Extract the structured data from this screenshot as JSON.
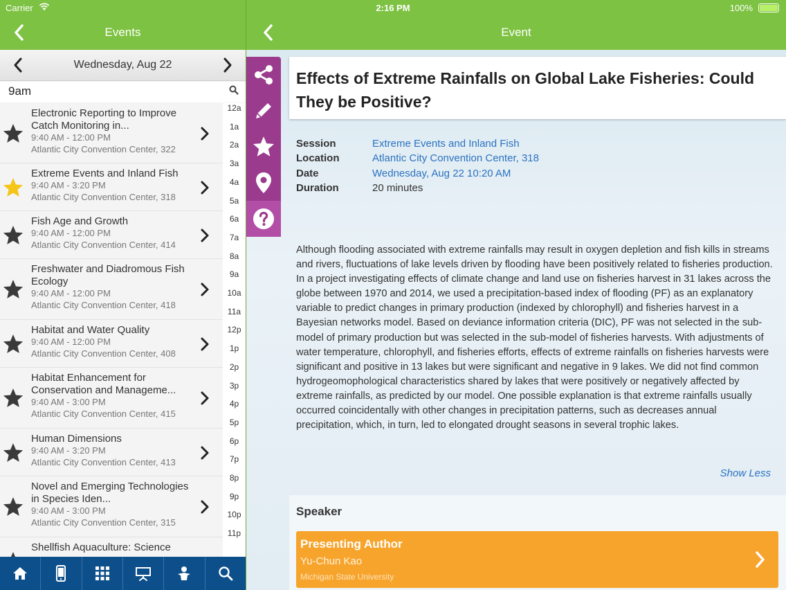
{
  "status_bar": {
    "carrier": "Carrier",
    "time": "2:16 PM",
    "battery": "100%"
  },
  "left_nav": {
    "title": "Events"
  },
  "right_nav": {
    "title": "Event"
  },
  "date_bar": {
    "date": "Wednesday, Aug 22"
  },
  "time_header": {
    "label": "9am"
  },
  "events": [
    {
      "title": "Electronic Reporting to Improve Catch Monitoring in...",
      "time": "9:40 AM - 12:00 PM",
      "location": "Atlantic City Convention Center, 322",
      "starred": false
    },
    {
      "title": "Extreme Events and Inland Fish",
      "time": "9:40 AM - 3:20 PM",
      "location": "Atlantic City Convention Center, 318",
      "starred": true
    },
    {
      "title": "Fish Age and Growth",
      "time": "9:40 AM - 12:00 PM",
      "location": "Atlantic City Convention Center, 414",
      "starred": false
    },
    {
      "title": "Freshwater and Diadromous Fish Ecology",
      "time": "9:40 AM - 12:00 PM",
      "location": "Atlantic City Convention Center, 418",
      "starred": false
    },
    {
      "title": "Habitat and Water Quality",
      "time": "9:40 AM - 12:00 PM",
      "location": "Atlantic City Convention Center, 408",
      "starred": false
    },
    {
      "title": "Habitat Enhancement for Conservation and Manageme...",
      "time": "9:40 AM - 3:00 PM",
      "location": "Atlantic City Convention Center, 415",
      "starred": false
    },
    {
      "title": "Human Dimensions",
      "time": "9:40 AM - 3:20 PM",
      "location": "Atlantic City Convention Center, 413",
      "starred": false
    },
    {
      "title": "Novel and Emerging Technologies in Species Iden...",
      "time": "9:40 AM - 3:00 PM",
      "location": "Atlantic City Convention Center, 315",
      "starred": false
    },
    {
      "title": "Shellfish Aquaculture: Science",
      "time": "",
      "location": "",
      "starred": false
    }
  ],
  "hour_index": [
    "12a",
    "1a",
    "2a",
    "3a",
    "4a",
    "5a",
    "6a",
    "7a",
    "8a",
    "9a",
    "10a",
    "11a",
    "12p",
    "1p",
    "2p",
    "3p",
    "4p",
    "5p",
    "6p",
    "7p",
    "8p",
    "9p",
    "10p",
    "11p"
  ],
  "tab_bar": {
    "tabs": [
      {
        "icon": "home-icon"
      },
      {
        "icon": "phone-icon"
      },
      {
        "icon": "grid-icon"
      },
      {
        "icon": "presentation-icon"
      },
      {
        "icon": "person-icon"
      },
      {
        "icon": "search-icon"
      }
    ]
  },
  "side_tools": [
    "share-icon",
    "pencil-icon",
    "star-icon",
    "location-pin-icon",
    "help-icon"
  ],
  "event_detail": {
    "title": "Effects of Extreme Rainfalls on Global Lake Fisheries: Could They be Positive?",
    "fields": [
      {
        "key": "Session",
        "value": "Extreme Events and Inland Fish",
        "link": true
      },
      {
        "key": "Location",
        "value": "Atlantic City Convention Center, 318",
        "link": true
      },
      {
        "key": "Date",
        "value": "Wednesday, Aug 22 10:20 AM",
        "link": true
      },
      {
        "key": "Duration",
        "value": "20 minutes",
        "link": false
      }
    ],
    "abstract": "Although flooding associated with extreme rainfalls may result in oxygen depletion and fish kills in streams and rivers, fluctuations of lake levels driven by flooding have been positively related to fisheries production. In a project investigating effects of climate change and land use on fisheries harvest in 31 lakes across the globe between 1970 and 2014, we used a precipitation-based index of flooding (PF) as an explanatory variable to predict changes in primary production (indexed by chlorophyll) and fisheries harvest in a Bayesian networks model. Based on deviance information criteria (DIC), PF was not selected in the sub-model of primary production but was selected in the sub-model of fisheries harvests. With adjustments of water temperature, chlorophyll, and fisheries efforts, effects of extreme rainfalls on fisheries harvests were significant and positive in 13 lakes but were significant and negative in 9 lakes. We did not find common hydrogeomophological characteristics shared by lakes that were positively or negatively affected by extreme rainfalls, as predicted by our model. One possible explanation is that extreme rainfalls usually occurred coincidentally with other changes in precipitation patterns, such as decreases annual precipitation, which, in turn, led to elongated drought seasons in several trophic lakes.",
    "show_less": "Show Less"
  },
  "speaker": {
    "heading": "Speaker",
    "role": "Presenting Author",
    "name": "Yu-Chun Kao",
    "organization": "Michigan State University"
  },
  "colors": {
    "nav_green": "#7dc242",
    "tab_blue": "#0d4f8b",
    "tool_purple": "#9b3b8e",
    "link_blue": "#2b72c0",
    "author_orange": "#f7a42d",
    "star_gold": "#f5c518"
  }
}
